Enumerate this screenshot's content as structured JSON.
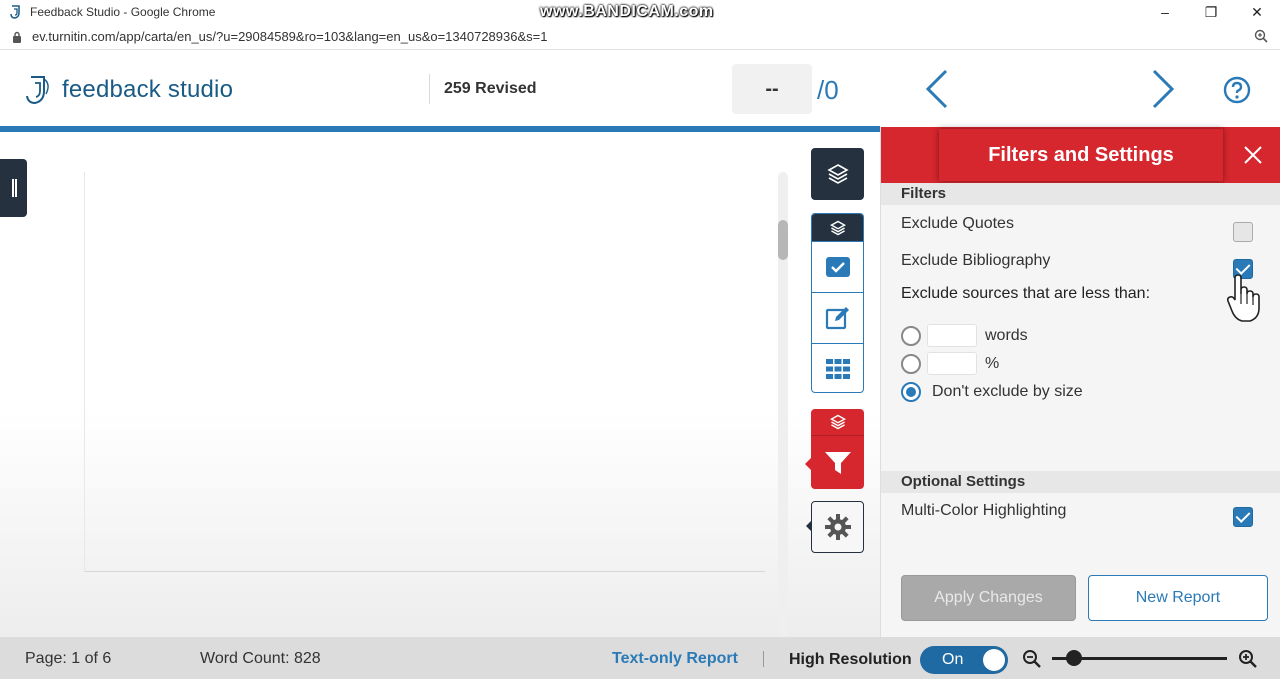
{
  "browser": {
    "window_title": "Feedback Studio - Google Chrome",
    "watermark": "www.BANDICAM.com",
    "url": "ev.turnitin.com/app/carta/en_us/?u=29084589&ro=103&lang=en_us&o=1340728936&s=1",
    "controls": {
      "minimize": "–",
      "restore": "❐",
      "close": "✕"
    }
  },
  "header": {
    "logo_text": "feedback studio",
    "submission_title": "259 Revised",
    "page_current": "--",
    "page_total": "/0"
  },
  "panel": {
    "title": "Filters and Settings",
    "filters_label": "Filters",
    "exclude_quotes": {
      "label": "Exclude Quotes",
      "checked": false
    },
    "exclude_bibliography": {
      "label": "Exclude Bibliography",
      "checked": true
    },
    "exclude_sources_label": "Exclude sources that are less than:",
    "size_options": [
      {
        "label": "words",
        "selected": false
      },
      {
        "label": "%",
        "selected": false
      },
      {
        "label": "Don't exclude by size",
        "selected": true
      }
    ],
    "optional_label": "Optional Settings",
    "multi_color": {
      "label": "Multi-Color Highlighting",
      "checked": true
    },
    "apply_label": "Apply Changes",
    "new_report_label": "New Report"
  },
  "footer": {
    "page_info": "Page: 1 of 6",
    "word_count": "Word Count: 828",
    "text_only": "Text-only Report",
    "high_resolution": "High Resolution",
    "toggle_state": "On"
  },
  "colors": {
    "brand_blue": "#2a7ab8",
    "panel_red": "#d6262e",
    "dark_navy": "#25313f"
  }
}
